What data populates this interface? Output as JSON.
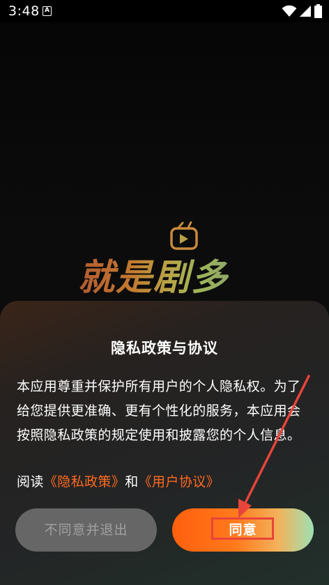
{
  "status_bar": {
    "time": "3:48",
    "notification_icon": "A"
  },
  "logo": {
    "text": "就是剧多",
    "icon": "tv-icon"
  },
  "dialog": {
    "title": "隐私政策与协议",
    "body": "本应用尊重并保护所有用户的个人隐私权。为了给您提供更准确、更有个性化的服务，本应用会按照隐私政策的规定使用和披露您的个人信息。",
    "links_prefix": "阅读",
    "privacy_link": "《隐私政策》",
    "links_and": "和",
    "agreement_link": "《用户协议》",
    "decline_label": "不同意并退出",
    "agree_label": "同意"
  },
  "colors": {
    "accent": "#ff6a1f",
    "annotation": "#e8453a"
  }
}
